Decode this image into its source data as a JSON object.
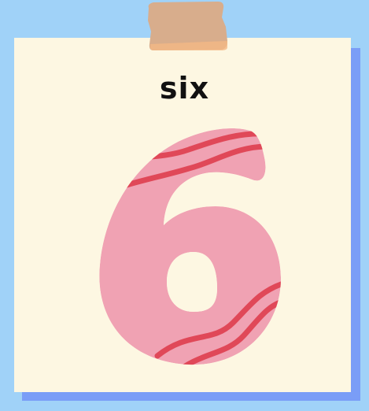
{
  "card": {
    "word": "six",
    "digit": "6"
  },
  "colors": {
    "background": "#a0d2f8",
    "card": "#fdf7e2",
    "card_shadow": "#7a9df7",
    "tape": "#d8ad8c",
    "digit_fill": "#f0a2b3",
    "digit_stripes": "#e04858",
    "text": "#111111"
  }
}
